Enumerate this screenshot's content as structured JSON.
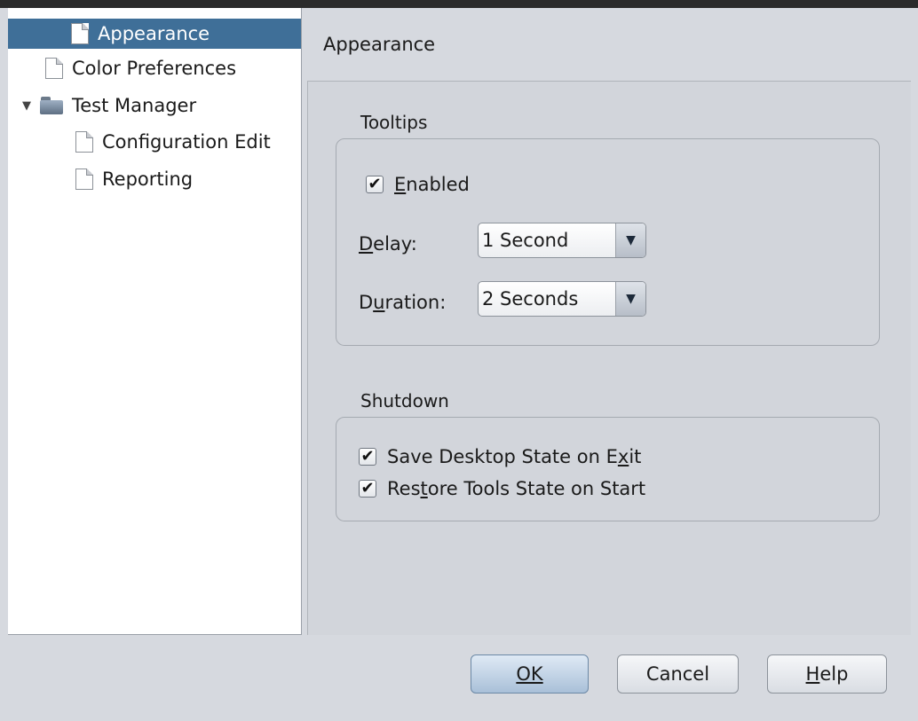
{
  "tree": {
    "items": [
      {
        "label": "Appearance",
        "type": "page",
        "selected": true
      },
      {
        "label": "Color Preferences",
        "type": "page"
      },
      {
        "label": "Test Manager",
        "type": "folder",
        "expanded": true
      },
      {
        "label": "Configuration Edit",
        "type": "page"
      },
      {
        "label": "Reporting",
        "type": "page"
      }
    ]
  },
  "header": {
    "title": "Appearance"
  },
  "tooltips": {
    "section_label": "Tooltips",
    "enabled_label": "Enabled",
    "enabled_checked": true,
    "delay_label": "Delay:",
    "delay_value": "1 Second",
    "duration_label": "Duration:",
    "duration_value": "2 Seconds"
  },
  "shutdown": {
    "section_label": "Shutdown",
    "save_label": "Save Desktop State on Exit",
    "save_checked": true,
    "restore_label": "Restore Tools State on Start",
    "restore_checked": true
  },
  "buttons": {
    "ok": "OK",
    "cancel": "Cancel",
    "help": "Help"
  },
  "icons": {
    "page": "page-icon",
    "folder": "folder-icon",
    "check": "✔",
    "dropdown": "▼",
    "expander": "▼"
  },
  "colors": {
    "selection": "#3f6f98",
    "panel": "#d2d5db",
    "window": "#d6d9df"
  }
}
